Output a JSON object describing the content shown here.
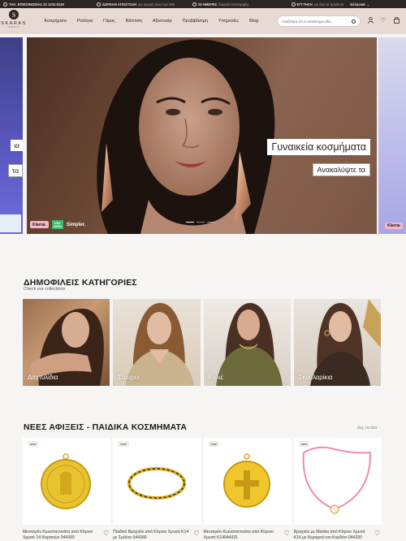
{
  "topbar": {
    "phone": "ΤΗΛ. ΕΠΙΚΟΙΝΩΝΙΑΣ 21 1234 8139",
    "shipping_bold": "ΔΩΡΕΑΝ ΑΠΟΣΤΟΛΗ",
    "shipping_sub": "για αγορές άνω των 30€",
    "returns_bold": "20 ΗΜΕΡΕΣ",
    "returns_sub": "δωρεάν επιστροφής",
    "warranty_bold": "ΕΓΓΥΗΣΗ",
    "warranty_sub": "για όλα τα προϊόντα",
    "language": "Ελληνικά"
  },
  "header": {
    "logo_word": "SKARAS",
    "logo_sub": "JEWELS",
    "nav": [
      "Κοσμήματα",
      "Ρολόγια",
      "Γάμος",
      "Βάπτιση",
      "Αξεσουάρ",
      "Προβιβάσιμη",
      "Υπηρεσίες",
      "Blog"
    ],
    "search_placeholder": "Αναζήτησε ότι το κατάστημα εδώ..."
  },
  "hero": {
    "left_pill_1": "ια",
    "left_pill_2": "τα",
    "title": "Γυναικεία κοσμήματα",
    "cta": "Ανακαλύψτε τα",
    "klarna": "Klarna.",
    "now_top": "PAY",
    "now_bottom": "NOW",
    "simpler": "Simpler.",
    "right_klarna": "Klarna"
  },
  "categories": {
    "title": "ΔΗΜΟΦΙΛΕΙΣ ΚΑΤΗΓΟΡΙΕΣ",
    "subtitle": "Check our collections",
    "items": [
      {
        "label": "Δαχτυλίδια"
      },
      {
        "label": "Σταυροί"
      },
      {
        "label": "Κολιέ"
      },
      {
        "label": "Σκουλαρίκια"
      }
    ]
  },
  "new_arrivals": {
    "title": "ΝΕΕΣ ΑΦΙΞΕΙΣ - ΠΑΙΔΙΚΑ ΚΟΣΜΗΜΑΤΑ",
    "see_all": "Δες τα όλα",
    "badge": "new",
    "products": [
      {
        "name": "Μενταγιόν Κωνσταντινάτο από Κίτρινο Χρυσό 14 Καρατιών 044393"
      },
      {
        "name": "Παιδικό Βραχιόλι από Κίτρινο Χρυσό Κ14 με Σμάλτο 044366"
      },
      {
        "name": "Μενταγιόν Κωνσταντινάτο από Κίτρινο Χρυσό Κ14044331"
      },
      {
        "name": "Βραχιόλι με Ματάκι από Κίτρινο Χρυσό Κ14 με Κεραμικό και Κορδόνι 044330"
      }
    ]
  }
}
